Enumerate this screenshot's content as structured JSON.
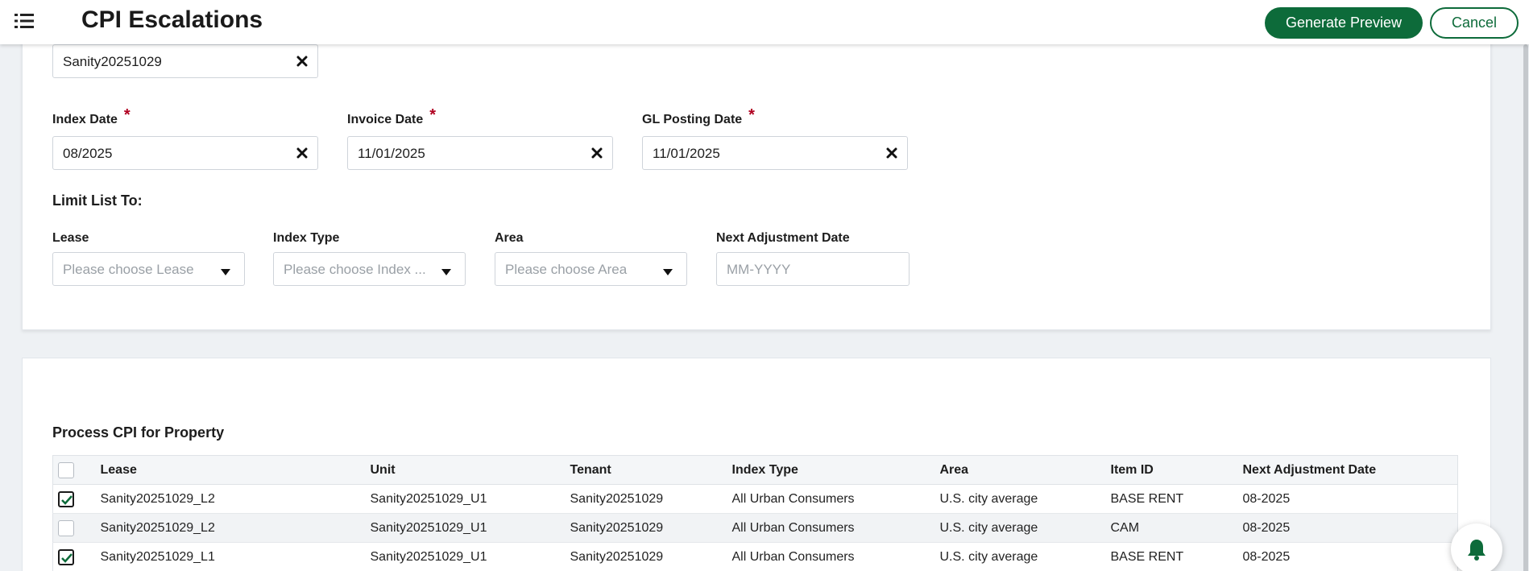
{
  "header": {
    "title": "CPI Escalations",
    "menu_icon": "list-menu-icon",
    "generate_label": "Generate Preview",
    "cancel_label": "Cancel"
  },
  "form": {
    "property_value": "Sanity20251029",
    "index_date": {
      "label": "Index Date",
      "required": "*",
      "value": "08/2025"
    },
    "invoice_date": {
      "label": "Invoice Date",
      "required": "*",
      "value": "11/01/2025"
    },
    "gl_posting_date": {
      "label": "GL Posting Date",
      "required": "*",
      "value": "11/01/2025"
    },
    "limit_title": "Limit List To:",
    "lease": {
      "label": "Lease",
      "placeholder": "Please choose Lease"
    },
    "index_type": {
      "label": "Index Type",
      "placeholder": "Please choose Index ..."
    },
    "area": {
      "label": "Area",
      "placeholder": "Please choose Area"
    },
    "next_adjustment": {
      "label": "Next Adjustment Date",
      "placeholder": "MM-YYYY"
    }
  },
  "process": {
    "title": "Process CPI for Property",
    "columns": [
      "Lease",
      "Unit",
      "Tenant",
      "Index Type",
      "Area",
      "Item ID",
      "Next Adjustment Date"
    ],
    "rows": [
      {
        "checked": true,
        "cells": [
          "Sanity20251029_L2",
          "Sanity20251029_U1",
          "Sanity20251029",
          "All Urban Consumers",
          "U.S. city average",
          "BASE RENT",
          "08-2025"
        ]
      },
      {
        "checked": false,
        "cells": [
          "Sanity20251029_L2",
          "Sanity20251029_U1",
          "Sanity20251029",
          "All Urban Consumers",
          "U.S. city average",
          "CAM",
          "08-2025"
        ]
      },
      {
        "checked": true,
        "cells": [
          "Sanity20251029_L1",
          "Sanity20251029_U1",
          "Sanity20251029",
          "All Urban Consumers",
          "U.S. city average",
          "BASE RENT",
          "08-2025"
        ]
      }
    ]
  },
  "colors": {
    "primary": "#0d6b3a",
    "required": "#b00020"
  },
  "notification_icon": "bell-icon"
}
